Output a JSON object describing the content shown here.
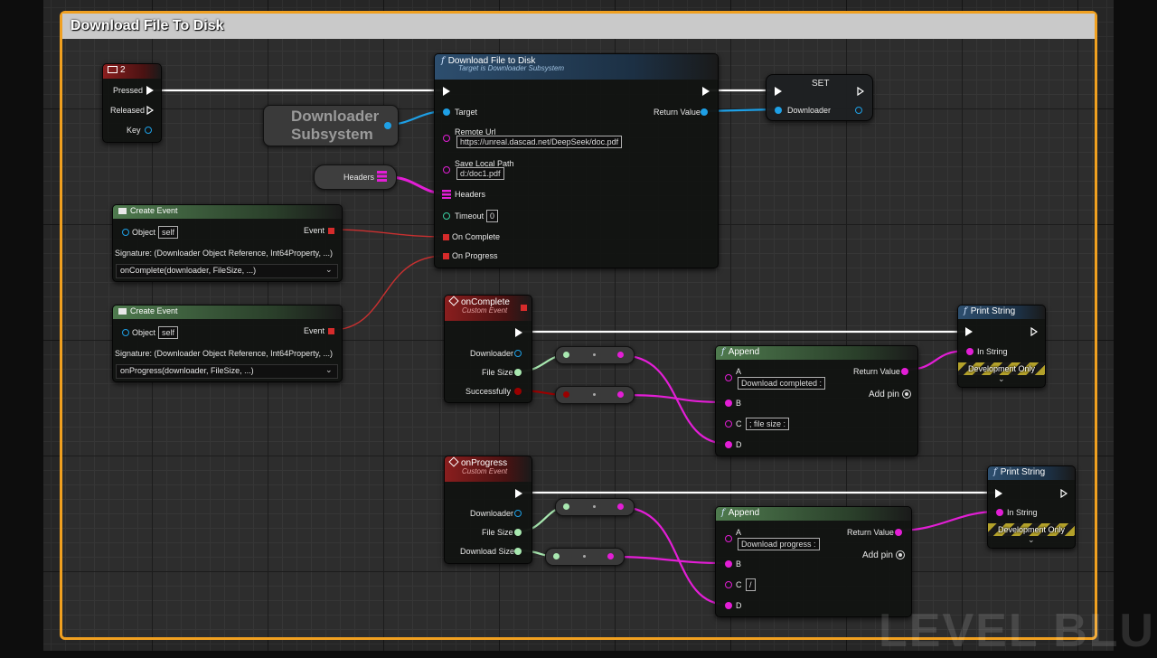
{
  "comment_title": "Download File To Disk",
  "watermark": "LEVEL BLU",
  "colors": {
    "exec_pin": "#ffffff",
    "object_pin": "#1ea0e6",
    "string_pin": "#e31ed6",
    "integer64_pin": "#a8e8b0",
    "boolean_pin": "#9a0000",
    "delegate_pin": "#e03030",
    "comment_border": "#f0a020"
  },
  "input_key_node": {
    "title": "2",
    "pressed": "Pressed",
    "released": "Released",
    "key": "Key"
  },
  "downloader_subsystem": {
    "line1": "Downloader",
    "line2": "Subsystem"
  },
  "headers_var": {
    "label": "Headers"
  },
  "download_node": {
    "title": "Download File to Disk",
    "subtitle": "Target is Downloader Subsystem",
    "target": "Target",
    "return_value": "Return Value",
    "remote_url_label": "Remote Url",
    "remote_url_value": "https://unreal.dascad.net/DeepSeek/doc.pdf",
    "save_path_label": "Save Local Path",
    "save_path_value": "d:/doc1.pdf",
    "headers": "Headers",
    "timeout_label": "Timeout",
    "timeout_value": "0",
    "on_complete": "On Complete",
    "on_progress": "On Progress"
  },
  "set_node": {
    "title": "SET",
    "downloader": "Downloader"
  },
  "create_event_1": {
    "title": "Create Event",
    "object_label": "Object",
    "object_value": "self",
    "event_label": "Event",
    "signature": "Signature: (Downloader Object Reference, Int64Property, ...)",
    "dropdown": "onComplete(downloader, FileSize, ...)"
  },
  "create_event_2": {
    "title": "Create Event",
    "object_label": "Object",
    "object_value": "self",
    "event_label": "Event",
    "signature": "Signature: (Downloader Object Reference, Int64Property, ...)",
    "dropdown": "onProgress(downloader, FileSize, ...)"
  },
  "on_complete_event": {
    "title": "onComplete",
    "subtitle": "Custom Event",
    "downloader": "Downloader",
    "file_size": "File Size",
    "successfully": "Successfully"
  },
  "on_progress_event": {
    "title": "onProgress",
    "subtitle": "Custom Event",
    "downloader": "Downloader",
    "file_size": "File Size",
    "download_size": "Download Size"
  },
  "append_1": {
    "title": "Append",
    "a": "A",
    "a_value": "Download completed :",
    "b": "B",
    "c": "C",
    "c_value": "; file size :",
    "d": "D",
    "return_value": "Return Value",
    "add_pin": "Add pin"
  },
  "append_2": {
    "title": "Append",
    "a": "A",
    "a_value": "Download progress :",
    "b": "B",
    "c": "C",
    "c_value": "/",
    "d": "D",
    "return_value": "Return Value",
    "add_pin": "Add pin"
  },
  "print_string_1": {
    "title": "Print String",
    "in_string": "In String",
    "dev_only": "Development Only"
  },
  "print_string_2": {
    "title": "Print String",
    "in_string": "In String",
    "dev_only": "Development Only"
  }
}
